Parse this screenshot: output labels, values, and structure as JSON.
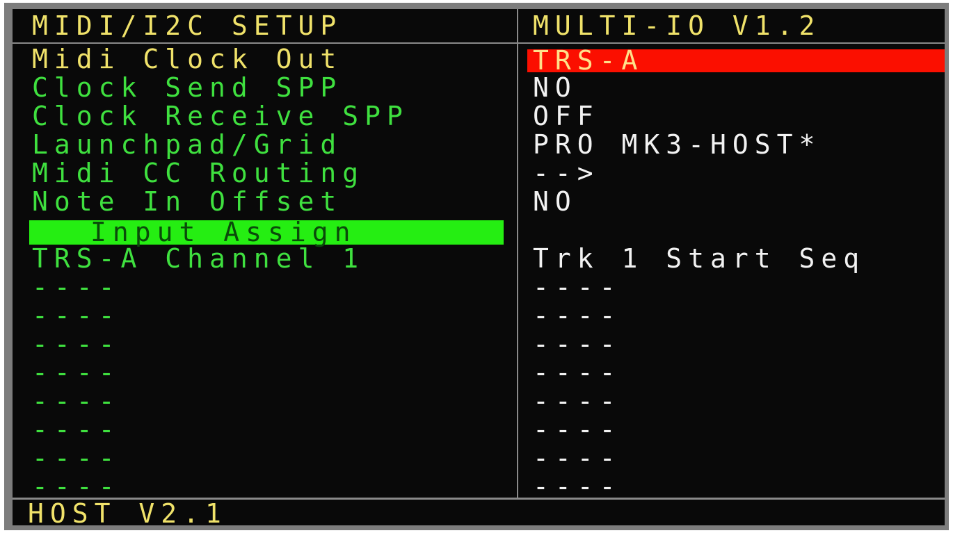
{
  "header": {
    "left_title": "MIDI/I2C SETUP",
    "right_title": "MULTI-IO V1.2"
  },
  "menu": {
    "items": [
      {
        "label": "Midi Clock Out",
        "value": "TRS-A"
      },
      {
        "label": "Clock Send SPP",
        "value": "NO"
      },
      {
        "label": "Clock Receive SPP",
        "value": "OFF"
      },
      {
        "label": "Launchpad/Grid",
        "value": "PRO MK3-HOST*"
      },
      {
        "label": "Midi CC Routing",
        "value": "-->"
      },
      {
        "label": "Note In Offset",
        "value": "NO"
      },
      {
        "label": "Input Assign",
        "value": ""
      },
      {
        "label": "TRS-A Channel 1",
        "value": "Trk 1 Start Seq"
      },
      {
        "label": "----",
        "value": "----"
      },
      {
        "label": "----",
        "value": "----"
      },
      {
        "label": "----",
        "value": "----"
      },
      {
        "label": "----",
        "value": "----"
      },
      {
        "label": "----",
        "value": "----"
      },
      {
        "label": "----",
        "value": "----"
      },
      {
        "label": "----",
        "value": "----"
      },
      {
        "label": "----",
        "value": "----"
      }
    ],
    "selected_label_index": 6,
    "selected_value_index": 0
  },
  "footer": {
    "status": "HOST V2.1"
  },
  "colors": {
    "background": "#090909",
    "header_text": "#f0e26a",
    "item_text": "#3fe03f",
    "value_text": "#f2f2f2",
    "label_highlight": "#25ee12",
    "value_highlight": "#fb0f00"
  }
}
